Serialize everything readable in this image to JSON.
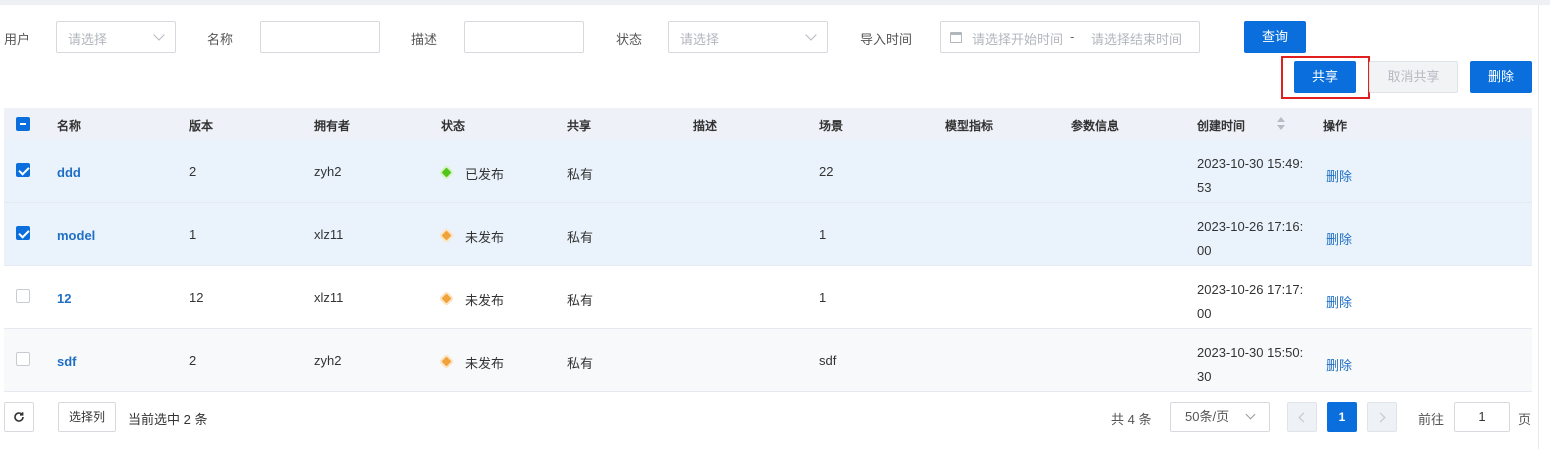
{
  "filters": {
    "user_label": "用户",
    "user_placeholder": "请选择",
    "name_label": "名称",
    "name_value": "",
    "desc_label": "描述",
    "desc_value": "",
    "status_label": "状态",
    "status_placeholder": "请选择",
    "import_time_label": "导入时间",
    "start_placeholder": "请选择开始时间",
    "range_separator": "-",
    "end_placeholder": "请选择结束时间",
    "query_button": "查询"
  },
  "actions": {
    "share_button": "共享",
    "unshare_button": "取消共享",
    "delete_button": "删除"
  },
  "table": {
    "columns": [
      "名称",
      "版本",
      "拥有者",
      "状态",
      "共享",
      "描述",
      "场景",
      "模型指标",
      "参数信息",
      "创建时间",
      "操作"
    ],
    "rows": [
      {
        "checked": true,
        "name": "ddd",
        "version": "2",
        "owner": "zyh2",
        "status": "已发布",
        "share": "私有",
        "desc": "",
        "scene": "22",
        "metric": "",
        "params": "",
        "created": "2023-10-30 15:49:53",
        "op": "删除"
      },
      {
        "checked": true,
        "name": "model",
        "version": "1",
        "owner": "xlz11",
        "status": "未发布",
        "share": "私有",
        "desc": "",
        "scene": "1",
        "metric": "",
        "params": "",
        "created": "2023-10-26 17:16:00",
        "op": "删除"
      },
      {
        "checked": false,
        "name": "12",
        "version": "12",
        "owner": "xlz11",
        "status": "未发布",
        "share": "私有",
        "desc": "",
        "scene": "1",
        "metric": "",
        "params": "",
        "created": "2023-10-26 17:17:00",
        "op": "删除"
      },
      {
        "checked": false,
        "name": "sdf",
        "version": "2",
        "owner": "zyh2",
        "status": "未发布",
        "share": "私有",
        "desc": "",
        "scene": "sdf",
        "metric": "",
        "params": "",
        "created": "2023-10-30 15:50:30",
        "op": "删除"
      }
    ]
  },
  "footer": {
    "select_columns_button": "选择列",
    "selected_info": "当前选中 2 条",
    "total": "共 4 条",
    "page_size": "50条/页",
    "current_page": "1",
    "goto_label": "前往",
    "goto_value": "1",
    "page_suffix": "页"
  },
  "colors": {
    "primary": "#0a6fdd",
    "published": "#52c41a",
    "unpublished": "#f0a33a",
    "highlight_box": "#e02020"
  },
  "icons": {
    "refresh": "refresh-icon",
    "calendar": "calendar-icon",
    "sort": "sort-icon"
  }
}
